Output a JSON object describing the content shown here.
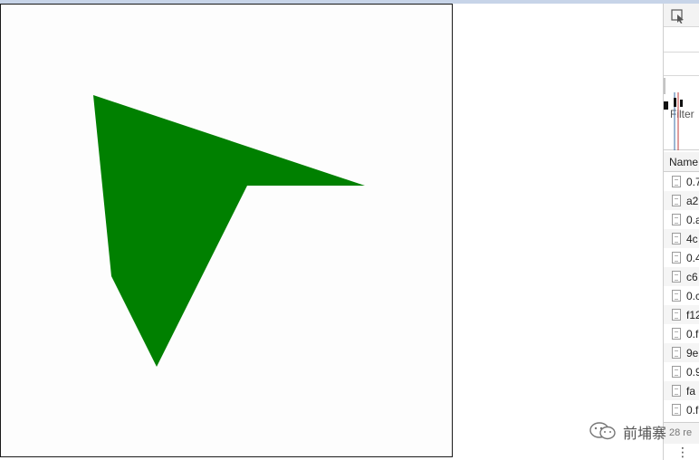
{
  "canvas": {
    "shape_color": "#008000",
    "frame_color": "#1a1a1a",
    "background": "#fdfdfd"
  },
  "devtools": {
    "inspect_icon": "cursor-inspect-icon",
    "record_icon": "record-icon",
    "record_color": "#e00000",
    "filter_label": "Filter",
    "name_header": "Name",
    "requests": [
      "0.7",
      "a2",
      "0.a",
      "4c",
      "0.4",
      "c6",
      "0.c",
      "f12",
      "0.f",
      "9e",
      "0.9",
      "fa",
      "0.f"
    ],
    "status": "28 re",
    "more_icon": "vertical-ellipsis-icon",
    "more_label": "⋮"
  },
  "watermark": {
    "icon": "wechat-icon",
    "text": "前埔寨"
  }
}
